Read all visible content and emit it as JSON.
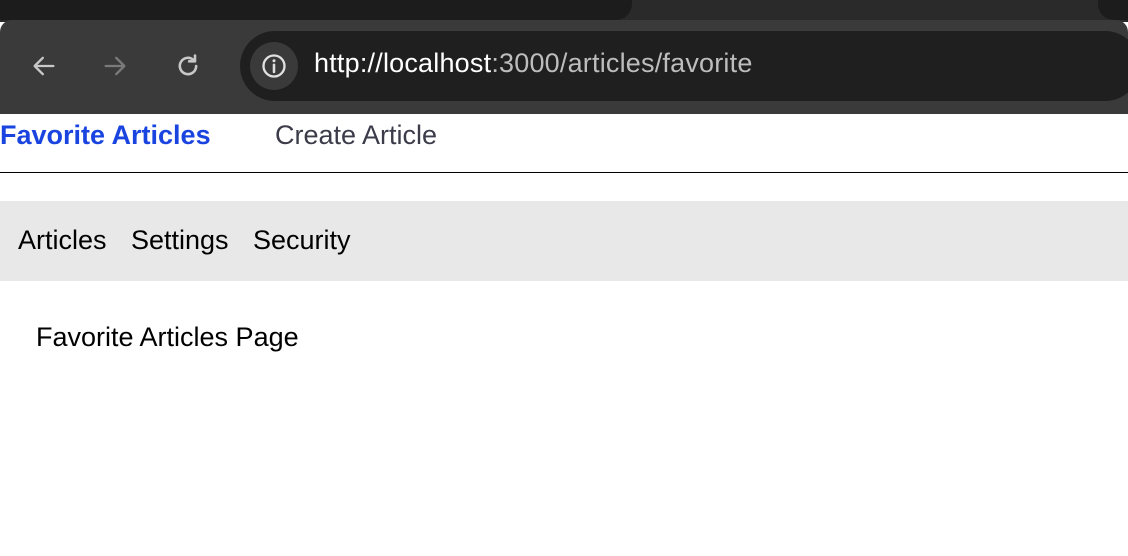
{
  "browser": {
    "url_host": "http://localhost",
    "url_path": ":3000/articles/favorite",
    "icons": [
      "back-arrow-icon",
      "forward-arrow-icon",
      "reload-icon",
      "site-info-icon"
    ]
  },
  "topnav": {
    "favorite": "Favorite Articles",
    "create": "Create Article"
  },
  "subnav": {
    "articles": "Articles",
    "settings": "Settings",
    "security": "Security"
  },
  "main": {
    "heading": "Favorite Articles Page"
  },
  "colors": {
    "active_link": "#1a44e0",
    "subnav_bg": "#e8e8e8",
    "chrome_bg": "#3a3a3a"
  }
}
